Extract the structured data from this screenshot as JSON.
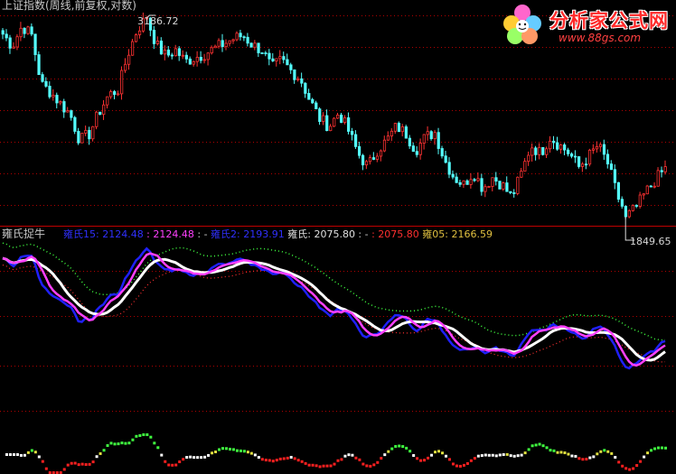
{
  "main_chart": {
    "title": "上证指数(周线,前复权,对数)",
    "high_label": "3186.72",
    "low_label": "1849.65"
  },
  "indicator": {
    "title": "雍氏捉牛",
    "legend": [
      {
        "text": "雍氏15: 2124.48",
        "color": "#3030ff"
      },
      {
        "text": " : 2124.48",
        "color": "#ff40ff"
      },
      {
        "text": " : - ",
        "color": "#c8c8c8"
      },
      {
        "text": "雍氏2: 2193.91",
        "color": "#3030ff"
      },
      {
        "text": " 雍氏: 2075.80",
        "color": "#e0e0e0"
      },
      {
        "text": " : - ",
        "color": "#c8c8c8"
      },
      {
        "text": " : 2075.80",
        "color": "#ff3030"
      },
      {
        "text": " 雍05: 2166.59",
        "color": "#e0c040"
      }
    ]
  },
  "logo": {
    "title": "分析家公式网",
    "url": "www.88gs.com"
  },
  "colors": {
    "background": "#000000",
    "up_candle": "#ff3232",
    "down_candle": "#54ffff",
    "grid": "#b00000"
  },
  "chart_data": {
    "type": "candlestick",
    "title": "上证指数(周线,前复权,对数)",
    "annotations": [
      {
        "text": "3186.72",
        "kind": "high"
      },
      {
        "text": "1849.65",
        "kind": "low"
      }
    ],
    "close_path": [
      3050,
      2950,
      3120,
      3040,
      2660,
      2600,
      2520,
      2450,
      2280,
      2320,
      2460,
      2580,
      2620,
      2880,
      3090,
      3186,
      2960,
      2870,
      2920,
      2830,
      2860,
      2890,
      2930,
      2970,
      3010,
      3040,
      2960,
      2920,
      2780,
      2840,
      2760,
      2700,
      2540,
      2420,
      2370,
      2460,
      2340,
      2200,
      2120,
      2220,
      2280,
      2370,
      2320,
      2220,
      2300,
      2330,
      2160,
      2060,
      2020,
      2090,
      2000,
      2060,
      2020,
      1950,
      2080,
      2250,
      2200,
      2300,
      2250,
      2200,
      2120,
      2180,
      2250,
      2140,
      1960,
      1849,
      1900,
      1980,
      2050,
      2110
    ]
  }
}
